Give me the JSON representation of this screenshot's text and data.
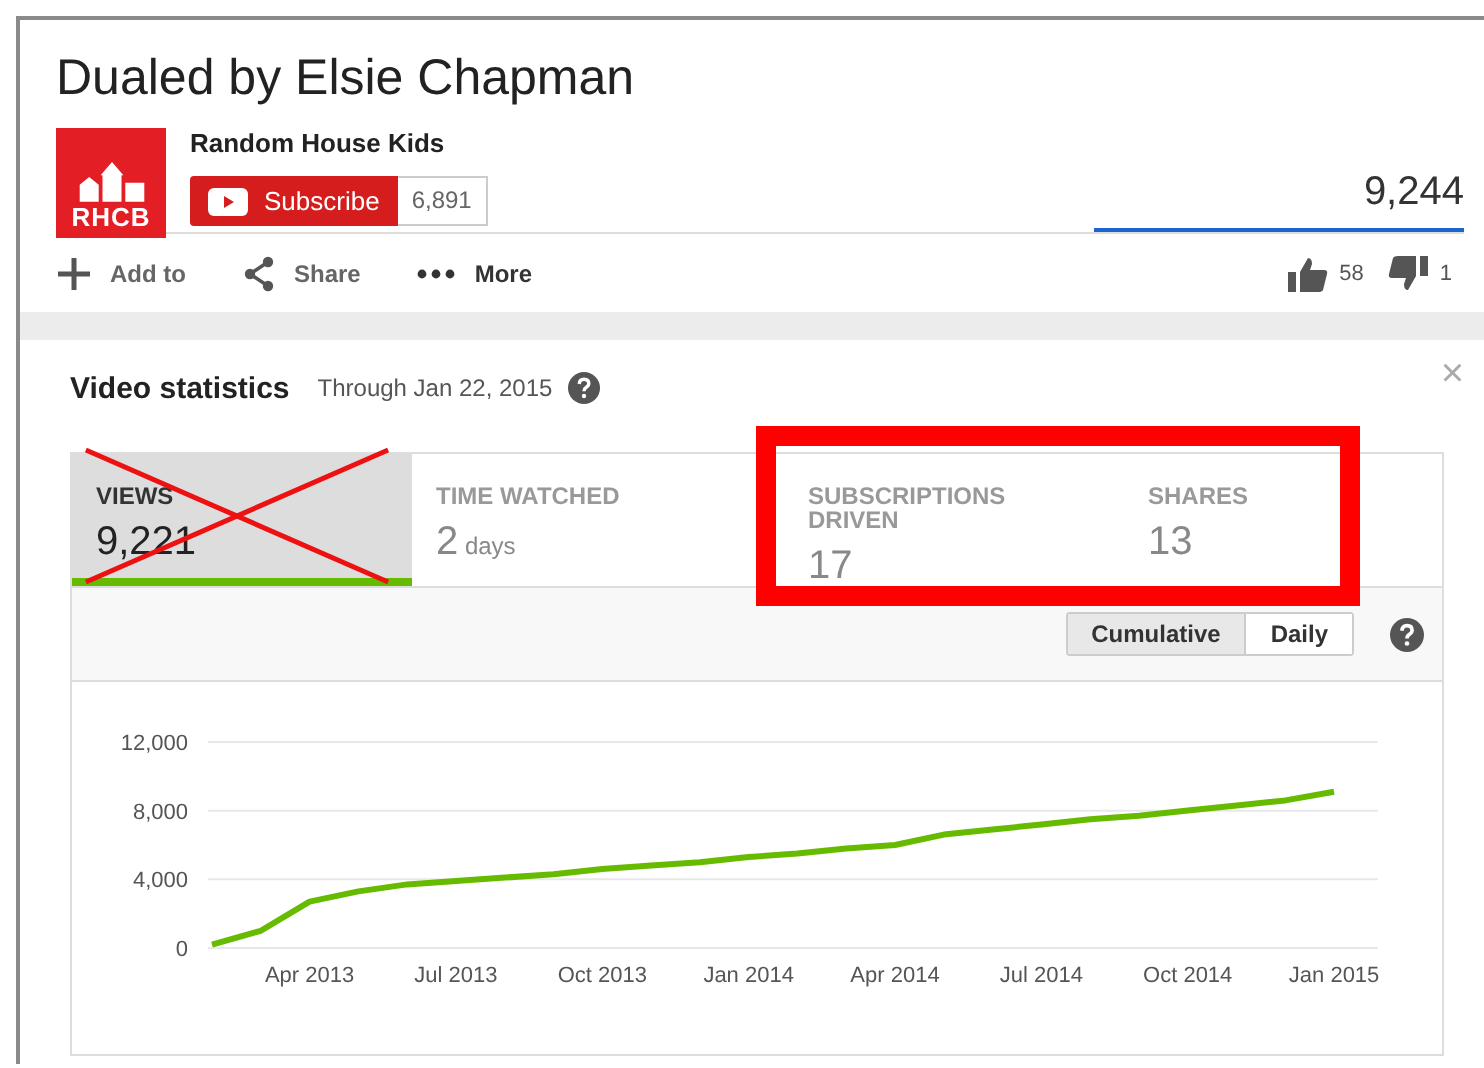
{
  "video": {
    "title": "Dualed by Elsie Chapman",
    "channel": "Random House Kids",
    "logo_text": "RHCB",
    "subscribe_label": "Subscribe",
    "subscriber_count": "6,891",
    "view_count": "9,244"
  },
  "actions": [
    {
      "kind": "add",
      "label": "Add to"
    },
    {
      "kind": "share",
      "label": "Share"
    },
    {
      "kind": "more",
      "label": "More"
    }
  ],
  "likes": "58",
  "dislikes": "1",
  "stats": {
    "title": "Video statistics",
    "through": "Through Jan 22, 2015",
    "close": "×",
    "metrics": [
      {
        "label": "VIEWS",
        "value": "9,221",
        "selected": true,
        "crossed_out": true,
        "highlighted": false
      },
      {
        "label": "TIME WATCHED",
        "value": "2",
        "unit": "days",
        "selected": false,
        "crossed_out": false,
        "highlighted": false
      },
      {
        "label": "SUBSCRIPTIONS DRIVEN",
        "value": "17",
        "selected": false,
        "crossed_out": false,
        "highlighted": true
      },
      {
        "label": "SHARES",
        "value": "13",
        "selected": false,
        "crossed_out": false,
        "highlighted": true
      }
    ],
    "modes": [
      {
        "label": "Cumulative",
        "selected": true
      },
      {
        "label": "Daily",
        "selected": false
      }
    ],
    "chart_data": {
      "type": "line",
      "categories": [
        null,
        null,
        "Apr 2013",
        null,
        null,
        "Jul 2013",
        null,
        null,
        "Oct 2013",
        null,
        null,
        "Jan 2014",
        null,
        null,
        "Apr 2014",
        null,
        null,
        "Jul 2014",
        null,
        null,
        "Oct 2014",
        null,
        null,
        "Jan 2015"
      ],
      "series": [
        {
          "color": "#66bb00",
          "values": [
            200,
            1000,
            2700,
            3300,
            3700,
            3900,
            4100,
            4300,
            4600,
            4800,
            5000,
            5300,
            5500,
            5800,
            6000,
            6600,
            6900,
            7200,
            7500,
            7700,
            8000,
            8300,
            8600,
            9100
          ]
        }
      ],
      "ylim": [
        0,
        12000
      ],
      "yticks": [
        {
          "value": 0,
          "label": "0"
        },
        {
          "value": 4000,
          "label": "4,000"
        },
        {
          "value": 8000,
          "label": "8,000"
        },
        {
          "value": 12000,
          "label": "12,000"
        }
      ]
    }
  }
}
